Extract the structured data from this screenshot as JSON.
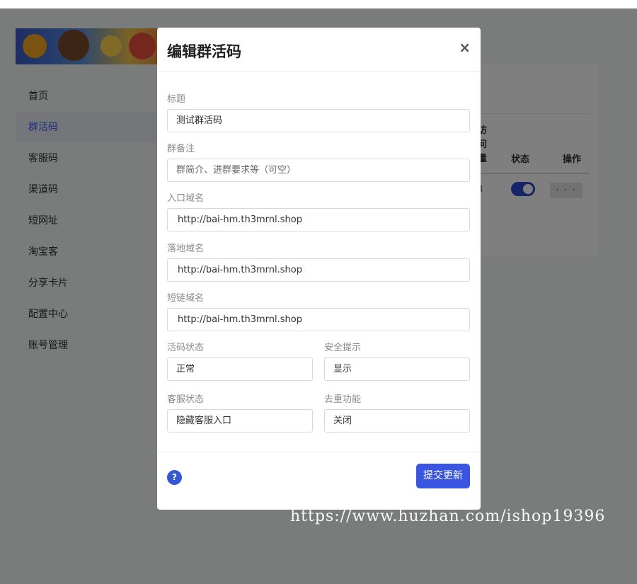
{
  "sidebar": {
    "items": [
      {
        "label": "首页"
      },
      {
        "label": "群活码"
      },
      {
        "label": "客服码"
      },
      {
        "label": "渠道码"
      },
      {
        "label": "短网址"
      },
      {
        "label": "淘宝客"
      },
      {
        "label": "分享卡片"
      },
      {
        "label": "配置中心"
      },
      {
        "label": "账号管理"
      }
    ],
    "active_index": 1
  },
  "table": {
    "partial_header_lines": [
      "访",
      "问",
      "量"
    ],
    "status_header": "状态",
    "ops_header": "操作",
    "row_partial": "4",
    "more_label": "· · ·",
    "toggle_on": true
  },
  "modal": {
    "title": "编辑群活码",
    "close_symbol": "×",
    "fields": {
      "title": {
        "label": "标题",
        "value": "测试群活码"
      },
      "remark": {
        "label": "群备注",
        "placeholder": "群简介、进群要求等（可空）"
      },
      "entry_domain": {
        "label": "入口域名",
        "value": "http://bai-hm.th3mrnl.shop"
      },
      "landing_domain": {
        "label": "落地域名",
        "value": "http://bai-hm.th3mrnl.shop"
      },
      "short_domain": {
        "label": "短链域名",
        "value": "http://bai-hm.th3mrnl.shop"
      },
      "code_status": {
        "label": "活码状态",
        "value": "正常"
      },
      "security_tip": {
        "label": "安全提示",
        "value": "显示"
      },
      "service_status": {
        "label": "客服状态",
        "value": "隐藏客服入口"
      },
      "dedupe": {
        "label": "去重功能",
        "value": "关闭"
      }
    },
    "help_symbol": "?",
    "submit_label": "提交更新"
  },
  "colors": {
    "accent": "#3a56e0",
    "overlay": "rgba(0,0,0,0.5)",
    "active_nav_text": "#3d5afe"
  },
  "watermark": "https://www.huzhan.com/ishop19396"
}
